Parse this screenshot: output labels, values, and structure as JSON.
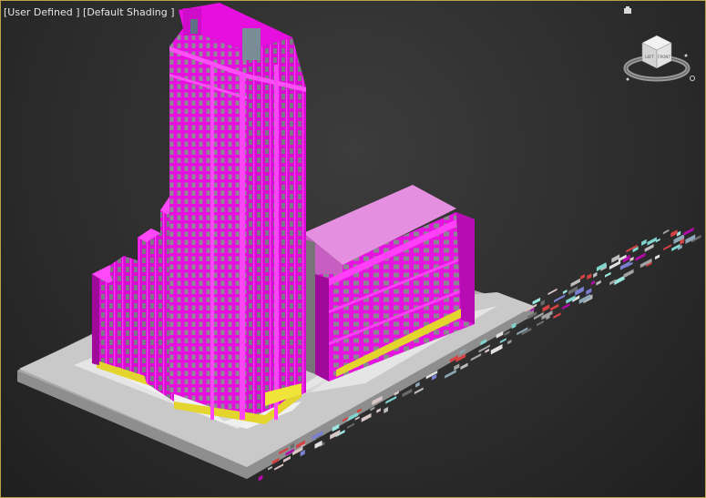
{
  "viewport": {
    "label": "[User Defined ] [Default Shading ]"
  },
  "viewcube": {
    "faces": {
      "left": "LEFT",
      "front": "FRONT",
      "top": "TOP"
    },
    "icon": "viewcube-icon"
  },
  "colors": {
    "facade": "#e60fe0",
    "facade_dark": "#b000ac",
    "window_glass": "#8b8b93",
    "roof": "#e58fe0",
    "awning": "#e3d42e",
    "ground_plate": "#c9c9c9",
    "sidewalk": "#e3e3e3",
    "frame": "#b9a34a"
  },
  "icons": {
    "light": "light-icon",
    "grid": "scattered-objects"
  }
}
